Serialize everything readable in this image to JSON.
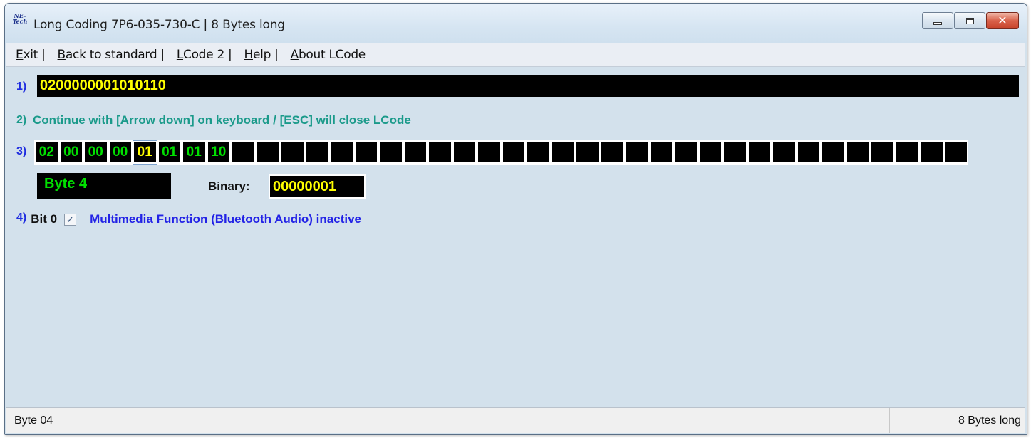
{
  "window": {
    "title": "Long Coding  7P6-035-730-C | 8 Bytes long",
    "icon_lines": [
      "NE-",
      "Tech"
    ],
    "close_glyph": "✕"
  },
  "menu": {
    "items": [
      {
        "underline": "E",
        "rest": "xit |"
      },
      {
        "underline": "B",
        "rest": "ack to standard |"
      },
      {
        "underline": "L",
        "rest": "Code 2 |"
      },
      {
        "underline": "H",
        "rest": "elp |"
      },
      {
        "underline": "A",
        "rest": "bout LCode"
      }
    ]
  },
  "step1": {
    "num": "1)",
    "coding": "0200000001010110"
  },
  "step2": {
    "num": "2)",
    "hint": "Continue with [Arrow down] on keyboard / [ESC] will close LCode"
  },
  "step3": {
    "num": "3)",
    "bytes": [
      "02",
      "00",
      "00",
      "00",
      "01",
      "01",
      "01",
      "10",
      "",
      "",
      "",
      "",
      "",
      "",
      "",
      "",
      "",
      "",
      "",
      "",
      "",
      "",
      "",
      "",
      "",
      "",
      "",
      "",
      "",
      "",
      "",
      "",
      "",
      "",
      "",
      "",
      "",
      ""
    ],
    "selected_index": 4,
    "byte_label": "Byte 4",
    "binary_label": "Binary:",
    "binary_value": "00000001"
  },
  "step4": {
    "num": "4)",
    "bit_label": "Bit 0",
    "checked": true,
    "check_glyph": "✓",
    "description": "Multimedia Function (Bluetooth Audio) inactive"
  },
  "status": {
    "left": "Byte 04",
    "right": "8 Bytes long"
  }
}
